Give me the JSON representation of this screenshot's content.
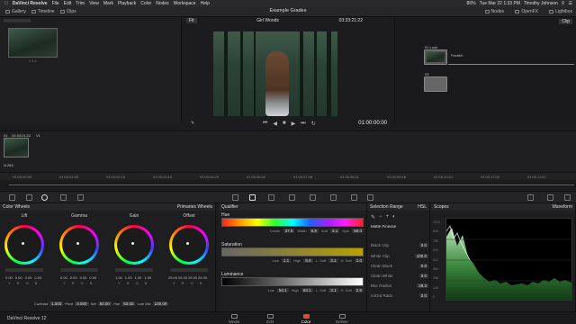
{
  "menubar": {
    "app": "DaVinci Resolve",
    "items": [
      "File",
      "Edit",
      "Trim",
      "View",
      "Mark",
      "Playback",
      "Color",
      "Nodes",
      "Workspace",
      "Help"
    ],
    "battery": "86%",
    "datetime": "Tue Mar 22  1:33 PM",
    "user": "Timothy Johnson"
  },
  "toolbar": {
    "left": [
      "Gallery",
      "Timeline",
      "Clips"
    ],
    "title": "Example Grades",
    "right": [
      "Nodes",
      "OpenFX",
      "Lightbox"
    ]
  },
  "gallery": {
    "still_label": "1.1.1"
  },
  "viewer": {
    "zoom": "Fit",
    "clip_name": "Girl Woods",
    "timecode": "03:33:21:22",
    "current_time": "01:00:00:00"
  },
  "nodes": {
    "mode": "Clip",
    "node1_label": "01  Look",
    "node1_name": "Parallel",
    "node2_label": "03"
  },
  "clips": {
    "clip_num": "01",
    "clip_tc": "03:33:21:22",
    "track": "V1",
    "codec": "H.264",
    "ruler": [
      "01:00:00:00",
      "01:00:01:05",
      "01:00:02:10",
      "01:00:03:15",
      "01:00:04:20",
      "01:00:06:01",
      "01:00:07:06",
      "01:00:08:11",
      "01:00:09:16",
      "01:00:10:21",
      "01:00:12:02",
      "01:00:13:07"
    ]
  },
  "wheels": {
    "title": "Color Wheels",
    "mode": "Primaries Wheels",
    "labels": [
      "Lift",
      "Gamma",
      "Gain",
      "Offset"
    ],
    "values": [
      [
        "0.00",
        "0.00",
        "0.00",
        "0.00"
      ],
      [
        "0.00",
        "0.00",
        "0.00",
        "0.00"
      ],
      [
        "1.00",
        "1.00",
        "1.00",
        "1.00"
      ],
      [
        "25.00",
        "25.00",
        "25.00",
        "25.00"
      ]
    ],
    "channels": [
      "Y",
      "R",
      "G",
      "B"
    ],
    "contrast_label": "Contrast",
    "contrast": "1.000",
    "pivot_label": "Pivot",
    "pivot": "0.500",
    "sat_label": "Sat",
    "sat": "50.00",
    "hue_label": "Hue",
    "hue": "50.00",
    "lummix_label": "Lum Mix",
    "lummix": "100.00"
  },
  "qualifier": {
    "title": "Qualifier",
    "hue": {
      "label": "Hue",
      "center_label": "Center",
      "center": "37.0",
      "width_label": "Width",
      "width": "6.9",
      "soft_label": "Soft",
      "soft": "3.1",
      "sym_label": "Sym",
      "sym": "50.0"
    },
    "sat": {
      "label": "Saturation",
      "low_label": "Low",
      "low": "1.1",
      "high_label": "High",
      "high": "5.8",
      "lsoft_label": "L. Soft",
      "lsoft": "3.1",
      "hsoft_label": "H. Soft",
      "hsoft": "1.0"
    },
    "lum": {
      "label": "Luminance",
      "low_label": "Low",
      "low": "54.1",
      "high_label": "High",
      "high": "63.1",
      "lsoft_label": "L. Soft",
      "lsoft": "3.1",
      "hsoft_label": "H. Soft",
      "hsoft": "2.5"
    }
  },
  "selection": {
    "title": "Selection Range",
    "mode": "HSL",
    "finesse": "Matte Finesse",
    "rows": [
      {
        "label": "Black Clip",
        "value": "0.0"
      },
      {
        "label": "White Clip",
        "value": "100.0"
      },
      {
        "label": "Clean Black",
        "value": "0.0"
      },
      {
        "label": "Clean White",
        "value": "0.0"
      },
      {
        "label": "Blur Radius",
        "value": "28.3"
      },
      {
        "label": "In/Out Ratio",
        "value": "0.0"
      }
    ]
  },
  "scopes": {
    "title": "Scopes",
    "type": "Waveform",
    "scale": [
      "1023",
      "896",
      "768",
      "640",
      "512",
      "384",
      "256",
      "128",
      "0"
    ]
  },
  "bottom": {
    "product": "DaVinci Resolve 12",
    "pages": [
      "Media",
      "Edit",
      "Color",
      "Deliver"
    ],
    "active": "Color"
  }
}
